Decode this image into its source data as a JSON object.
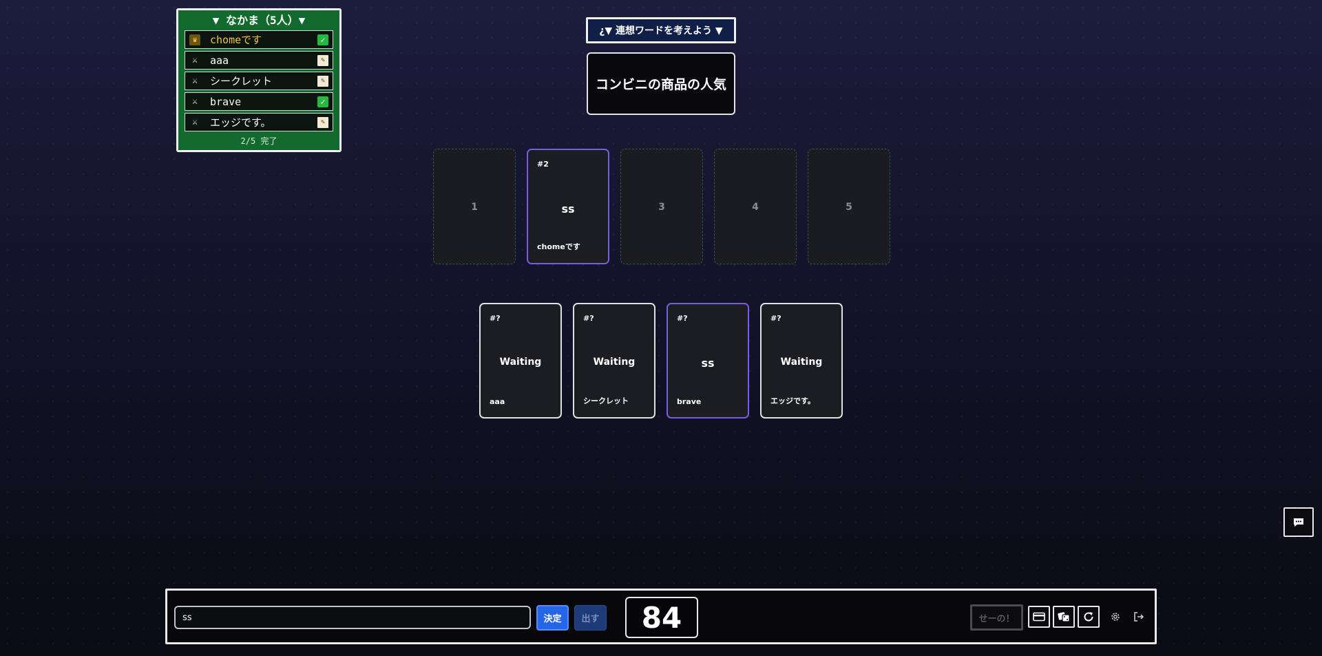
{
  "party": {
    "title": "▼ なかま（5人）▼",
    "members": [
      {
        "name": "chomeです",
        "role": "crown",
        "status": "done"
      },
      {
        "name": "aaa",
        "role": "swords",
        "status": "writing"
      },
      {
        "name": "シークレット",
        "role": "swords",
        "status": "writing"
      },
      {
        "name": "brave",
        "role": "swords",
        "status": "done"
      },
      {
        "name": "エッジです。",
        "role": "swords",
        "status": "writing"
      }
    ],
    "footer": "2/5 完了"
  },
  "theme": {
    "header": "¿▼ 連想ワードを考えよう ▼",
    "text": "コンビニの商品の人気"
  },
  "slots": [
    {
      "label": "1"
    },
    {
      "tag": "#2",
      "word": "ss",
      "owner": "chomeです"
    },
    {
      "label": "3"
    },
    {
      "label": "4"
    },
    {
      "label": "5"
    }
  ],
  "hand": [
    {
      "tag": "#?",
      "word": "Waiting",
      "owner": "aaa"
    },
    {
      "tag": "#?",
      "word": "Waiting",
      "owner": "シークレット"
    },
    {
      "tag": "#?",
      "word": "ss",
      "owner": "brave"
    },
    {
      "tag": "#?",
      "word": "Waiting",
      "owner": "エッジです。"
    }
  ],
  "controls": {
    "input_value": "ss",
    "decide_label": "決定",
    "submit_label": "出す",
    "timer": "84",
    "seeno_label": "せーの！"
  },
  "icons": {
    "chat": "chat-icon",
    "card": "card-icon",
    "dice": "dice-icon",
    "reset": "refresh-icon",
    "settings": "gear-icon",
    "exit": "exit-icon"
  },
  "colors": {
    "party_bg": "#136a2e",
    "accent_purple": "#7a5ce0",
    "decide_blue": "#2565e8",
    "host_gold": "#f0c33a"
  }
}
